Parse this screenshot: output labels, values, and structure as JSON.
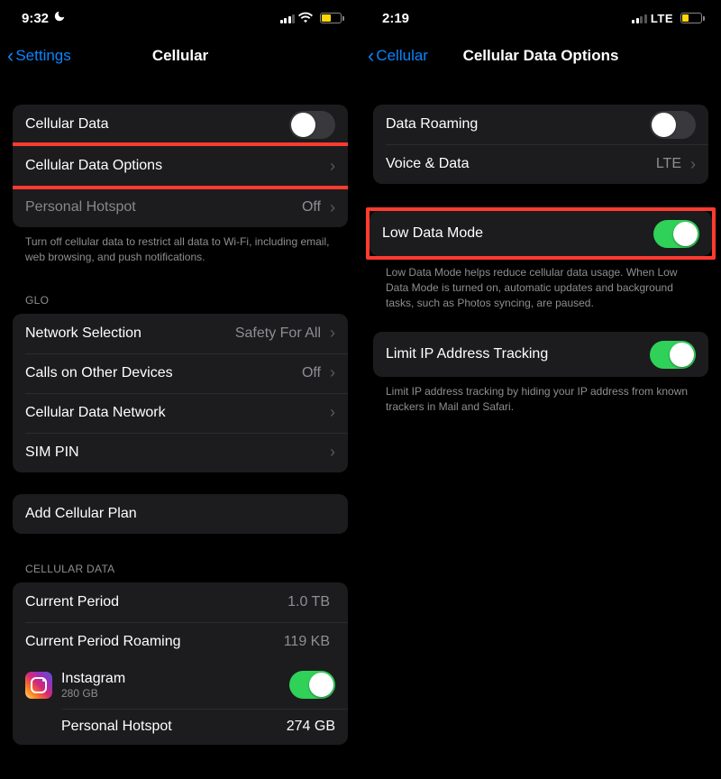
{
  "left": {
    "status": {
      "time": "9:32",
      "battery_pct": 45
    },
    "nav": {
      "back": "Settings",
      "title": "Cellular"
    },
    "group1": {
      "cellular_data": "Cellular Data",
      "cellular_data_options": "Cellular Data Options",
      "personal_hotspot": "Personal Hotspot",
      "personal_hotspot_value": "Off"
    },
    "footer1": "Turn off cellular data to restrict all data to Wi-Fi, including email, web browsing, and push notifications.",
    "header_glo": "GLO",
    "group2": {
      "network_selection": "Network Selection",
      "network_selection_value": "Safety For All",
      "calls_other": "Calls on Other Devices",
      "calls_other_value": "Off",
      "cdn": "Cellular Data Network",
      "sim_pin": "SIM PIN"
    },
    "add_plan": "Add Cellular Plan",
    "header_cd": "CELLULAR DATA",
    "group4": {
      "current_period": "Current Period",
      "current_period_value": "1.0 TB",
      "roaming": "Current Period Roaming",
      "roaming_value": "119 KB",
      "app_name": "Instagram",
      "app_size": "280 GB",
      "sub_name": "Personal Hotspot",
      "sub_value": "274 GB"
    }
  },
  "right": {
    "status": {
      "time": "2:19",
      "network": "LTE",
      "battery_pct": 30
    },
    "nav": {
      "back": "Cellular",
      "title": "Cellular Data Options"
    },
    "group1": {
      "data_roaming": "Data Roaming",
      "voice_data": "Voice & Data",
      "voice_data_value": "LTE"
    },
    "group2": {
      "low_data_mode": "Low Data Mode"
    },
    "footer2": "Low Data Mode helps reduce cellular data usage. When Low Data Mode is turned on, automatic updates and background tasks, such as Photos syncing, are paused.",
    "group3": {
      "limit_ip": "Limit IP Address Tracking"
    },
    "footer3": "Limit IP address tracking by hiding your IP address from known trackers in Mail and Safari."
  }
}
